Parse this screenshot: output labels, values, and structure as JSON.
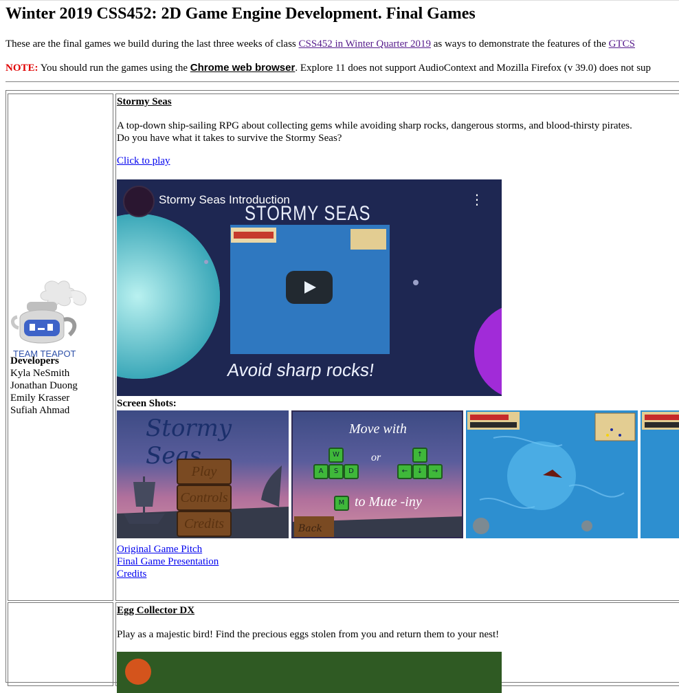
{
  "page": {
    "title": "Winter 2019 CSS452: 2D Game Engine Development. Final Games",
    "intro_prefix": "These are the final games we build during the last three weeks of class ",
    "intro_link": "CSS452 in Winter Quarter 2019",
    "intro_mid": " as ways to demonstrate the features of the ",
    "intro_link2": "GTCS",
    "note_label": "NOTE:",
    "note_prefix": " You should run the games using the ",
    "note_browser": "Chrome web browser",
    "note_suffix": ". Explore 11 does not support AudioContext and Mozilla Firefox (v 39.0) does not sup"
  },
  "games": [
    {
      "team": "TEAM TEAPOT",
      "developers_label": "Developers",
      "developers": [
        "Kyla NeSmith",
        "Jonathan Duong",
        "Emily Krasser",
        "Sufiah Ahmad"
      ],
      "title": "Stormy Seas",
      "description_1": "A top-down ship-sailing RPG about collecting gems while avoiding sharp rocks, dangerous storms, and blood-thirsty pirates.",
      "description_2": "Do you have what it takes to survive the Stormy Seas?",
      "play_link": "Click to play",
      "video_title": "Stormy Seas Introduction",
      "video_banner": "STORMY SEAS",
      "video_caption": "Avoid sharp rocks!",
      "screenshots_label": "Screen Shots:",
      "shot1_title": "Stormy Seas",
      "shot1_menu": [
        "Play",
        "Controls",
        "Credits"
      ],
      "shot2_text_1": "Move with",
      "shot2_text_2": "or",
      "shot2_text_3": "to Mute -iny",
      "shot2_back": "Back",
      "links": [
        "Original Game Pitch",
        "Final Game Presentation",
        "Credits"
      ]
    },
    {
      "title": "Egg Collector DX",
      "description_1": "Play as a majestic bird! Find the precious eggs stolen from you and return them to your nest!"
    }
  ],
  "colors": {
    "note": "#e00000",
    "link": "#0000ee",
    "visited": "#551a8b"
  }
}
